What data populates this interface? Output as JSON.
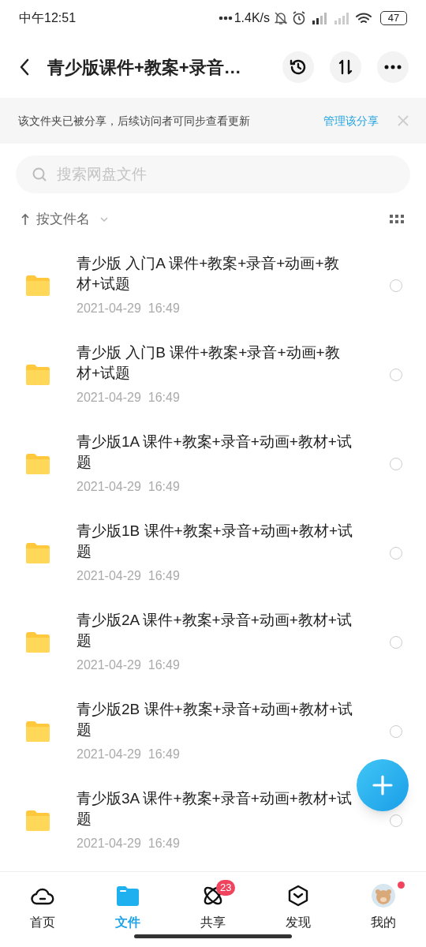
{
  "status_bar": {
    "time": "中午12:51",
    "net_speed": "1.4K/s",
    "battery": "47"
  },
  "header": {
    "title": "青少版课件+教案+录音…"
  },
  "banner": {
    "text": "该文件夹已被分享，后续访问者可同步查看更新",
    "action": "管理该分享"
  },
  "search": {
    "placeholder": "搜索网盘文件"
  },
  "sort": {
    "label": "按文件名"
  },
  "files": [
    {
      "name": "青少版 入门A 课件+教案+录音+动画+教材+试题",
      "date": "2021-04-29  16:49",
      "selected": false
    },
    {
      "name": "青少版 入门B 课件+教案+录音+动画+教材+试题",
      "date": "2021-04-29  16:49",
      "selected": false
    },
    {
      "name": "青少版1A 课件+教案+录音+动画+教材+试题",
      "date": "2021-04-29  16:49",
      "selected": false
    },
    {
      "name": "青少版1B 课件+教案+录音+动画+教材+试题",
      "date": "2021-04-29  16:49",
      "selected": false
    },
    {
      "name": "青少版2A 课件+教案+录音+动画+教材+试题",
      "date": "2021-04-29  16:49",
      "selected": false
    },
    {
      "name": "青少版2B 课件+教案+录音+动画+教材+试题",
      "date": "2021-04-29  16:49",
      "selected": false
    },
    {
      "name": "青少版3A 课件+教案+录音+动画+教材+试题",
      "date": "2021-04-29  16:49",
      "selected": false
    }
  ],
  "nav": [
    {
      "label": "首页",
      "selected": false
    },
    {
      "label": "文件",
      "selected": true
    },
    {
      "label": "共享",
      "selected": false,
      "badge": "23"
    },
    {
      "label": "发现",
      "selected": false
    },
    {
      "label": "我的",
      "selected": false,
      "dot": true
    }
  ]
}
